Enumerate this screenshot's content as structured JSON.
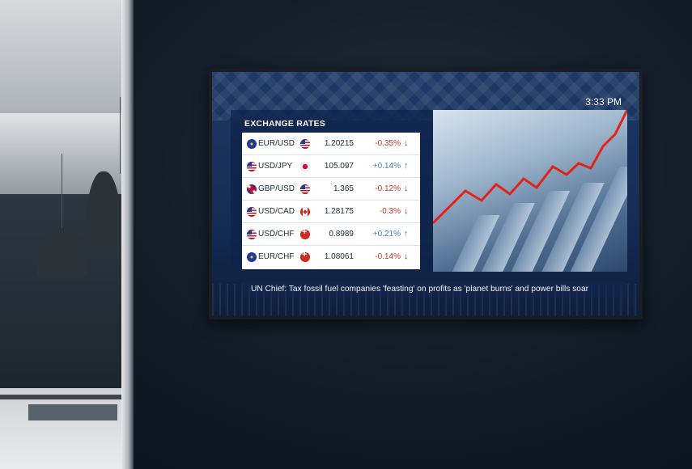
{
  "screen": {
    "time": "3:33 PM",
    "panel_title": "EXCHANGE RATES",
    "rates": [
      {
        "pair": "EUR/USD",
        "base_flag": "eu-flag-icon",
        "quote_flag": "us-flag-icon",
        "price": "1.20215",
        "change": "-0.35%",
        "direction": "down"
      },
      {
        "pair": "USD/JPY",
        "base_flag": "us-flag-icon",
        "quote_flag": "jp-flag-icon",
        "price": "105.097",
        "change": "+0.14%",
        "direction": "up"
      },
      {
        "pair": "GBP/USD",
        "base_flag": "gb-flag-icon",
        "quote_flag": "us-flag-icon",
        "price": "1.365",
        "change": "-0.12%",
        "direction": "down"
      },
      {
        "pair": "USD/CAD",
        "base_flag": "us-flag-icon",
        "quote_flag": "ca-flag-icon",
        "price": "1.28175",
        "change": "-0.3%",
        "direction": "down"
      },
      {
        "pair": "USD/CHF",
        "base_flag": "us-flag-icon",
        "quote_flag": "ch-flag-icon",
        "price": "0.8989",
        "change": "+0.21%",
        "direction": "up"
      },
      {
        "pair": "EUR/CHF",
        "base_flag": "eu-flag-icon",
        "quote_flag": "ch-flag-icon",
        "price": "1.08061",
        "change": "-0.14%",
        "direction": "down"
      }
    ],
    "ticker": "UN Chief: Tax fossil fuel companies 'feasting' on profits as 'planet burns' and power bills soar",
    "colors": {
      "negative": "#c8342c",
      "positive": "#3a83b8",
      "trend_line": "#e2231a"
    }
  }
}
